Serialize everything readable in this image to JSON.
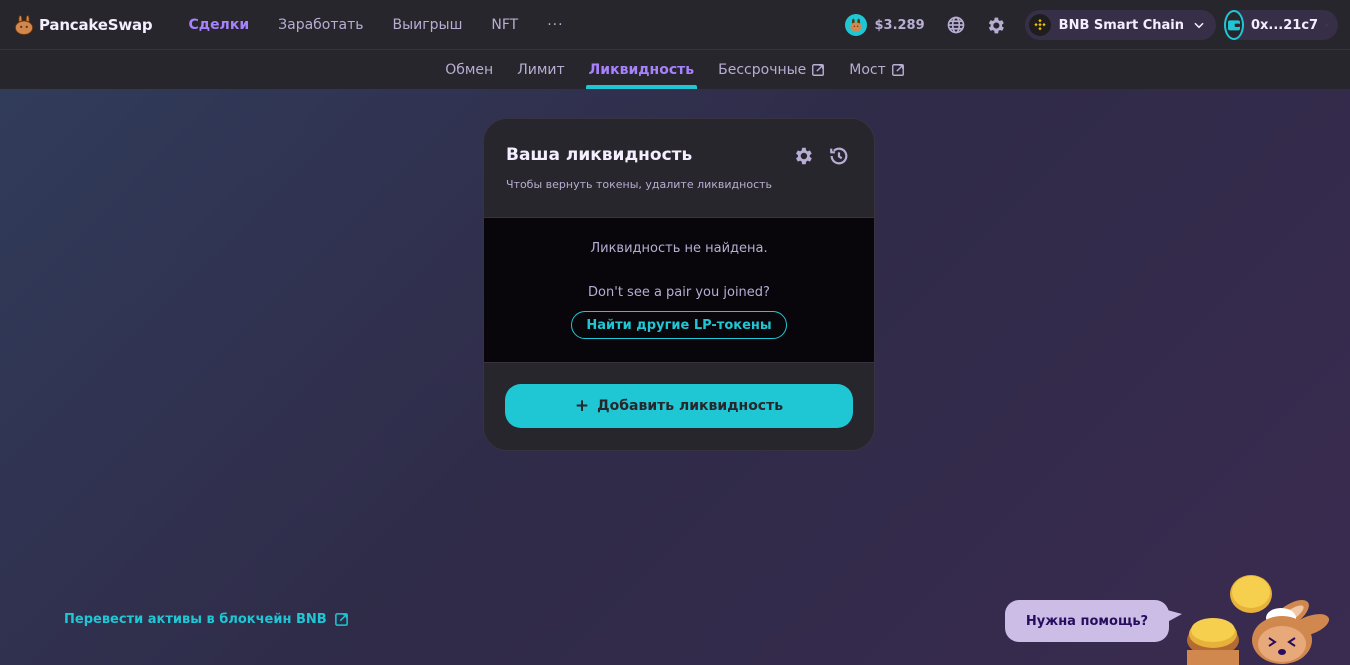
{
  "brand": {
    "name": "PancakeSwap"
  },
  "nav": {
    "items": [
      {
        "label": "Сделки",
        "active": true
      },
      {
        "label": "Заработать",
        "active": false
      },
      {
        "label": "Выигрыш",
        "active": false
      },
      {
        "label": "NFT",
        "active": false
      }
    ],
    "more": "···"
  },
  "header": {
    "cake_price": "$3.289",
    "chain": "BNB Smart Chain",
    "wallet": "0x...21c7"
  },
  "subnav": {
    "items": [
      {
        "label": "Обмен",
        "active": false,
        "external": false
      },
      {
        "label": "Лимит",
        "active": false,
        "external": false
      },
      {
        "label": "Ликвидность",
        "active": true,
        "external": false
      },
      {
        "label": "Бессрочные",
        "active": false,
        "external": true
      },
      {
        "label": "Мост",
        "active": false,
        "external": true
      }
    ]
  },
  "card": {
    "title": "Ваша ликвидность",
    "subtitle": "Чтобы вернуть токены, удалите ликвидность",
    "empty": "Ликвидность не найдена.",
    "dont_see": "Don't see a pair you joined?",
    "find_button": "Найти другие LP-токены",
    "add_button": "Добавить ликвидность",
    "add_plus": "+"
  },
  "footer": {
    "bridge_link": "Перевести активы в блокчейн BNB",
    "help": "Нужна помощь?"
  },
  "colors": {
    "accent": "#1fc7d4",
    "active_nav": "#a881fc",
    "card_bg": "#27262c",
    "body_bg": "#08060b",
    "text_secondary": "#b8add2"
  },
  "icons": {
    "logo": "bunny-logo-icon",
    "price": "cake-token-icon",
    "language": "globe-icon",
    "settings": "gear-icon",
    "chain": "bnb-chain-icon",
    "wallet": "wallet-icon",
    "history": "history-icon",
    "external": "external-link-icon"
  }
}
